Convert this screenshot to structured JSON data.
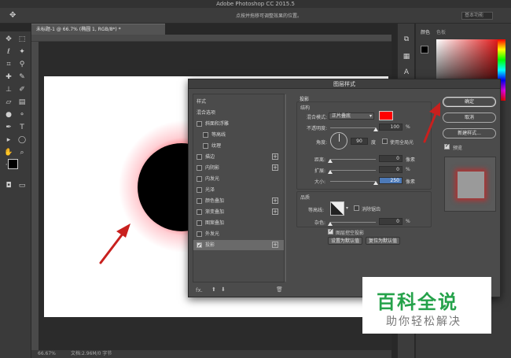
{
  "app": {
    "title": "Adobe Photoshop CC 2015.5"
  },
  "options_bar": {
    "hint": "点按并拖移可调整效果的位置。",
    "workspace": "基本功能"
  },
  "document": {
    "tab_title": "未标题-1 @ 66.7% (椭圆 1, RGB/8*) *",
    "zoom": "66.67%",
    "doc_info": "文档:2.96M/0 字节"
  },
  "right_panel": {
    "tab_color": "颜色",
    "tab_swatches": "色板",
    "fg_color": "#000000",
    "bg_color": "#ffffff"
  },
  "dialog": {
    "title": "图层样式",
    "list_header": "样式",
    "blend_options": "混合选项",
    "items": [
      {
        "label": "斜面和浮雕",
        "checked": false,
        "plus": false,
        "indent": false
      },
      {
        "label": "等高线",
        "checked": false,
        "plus": false,
        "indent": true
      },
      {
        "label": "纹理",
        "checked": false,
        "plus": false,
        "indent": true
      },
      {
        "label": "描边",
        "checked": false,
        "plus": true,
        "indent": false
      },
      {
        "label": "内阴影",
        "checked": false,
        "plus": true,
        "indent": false
      },
      {
        "label": "内发光",
        "checked": false,
        "plus": false,
        "indent": false
      },
      {
        "label": "光泽",
        "checked": false,
        "plus": false,
        "indent": false
      },
      {
        "label": "颜色叠加",
        "checked": false,
        "plus": true,
        "indent": false
      },
      {
        "label": "渐变叠加",
        "checked": false,
        "plus": true,
        "indent": false
      },
      {
        "label": "图案叠加",
        "checked": false,
        "plus": false,
        "indent": false
      },
      {
        "label": "外发光",
        "checked": false,
        "plus": false,
        "indent": false
      },
      {
        "label": "投影",
        "checked": true,
        "plus": true,
        "indent": false,
        "selected": true
      }
    ],
    "fx": "fx.",
    "section_title": "投影",
    "structure": {
      "title": "结构",
      "blend_mode_label": "混合模式:",
      "blend_mode_value": "正片叠底",
      "shadow_color": "#ff0000",
      "opacity_label": "不透明度:",
      "opacity_value": "100",
      "angle_label": "角度:",
      "angle_value": "90",
      "angle_unit": "度",
      "global_light_label": "使用全局光",
      "distance_label": "距离:",
      "distance_value": "0",
      "distance_unit": "像素",
      "spread_label": "扩展:",
      "spread_value": "0",
      "size_label": "大小:",
      "size_value": "250",
      "size_unit": "像素",
      "percent": "%"
    },
    "quality": {
      "title": "品质",
      "contour_label": "等高线:",
      "antialias_label": "消除锯齿",
      "noise_label": "杂色:",
      "noise_value": "0",
      "percent": "%"
    },
    "knockout_label": "图层挖空投影",
    "set_default": "设置为默认值",
    "reset_default": "复位为默认值",
    "ok": "确定",
    "cancel": "取消",
    "new_style": "新建样式...",
    "preview_label": "预览"
  },
  "watermark": {
    "line1": "百科全说",
    "line2": "助你轻松解决"
  },
  "annotation": {
    "arrow_color": "#c8201e"
  }
}
